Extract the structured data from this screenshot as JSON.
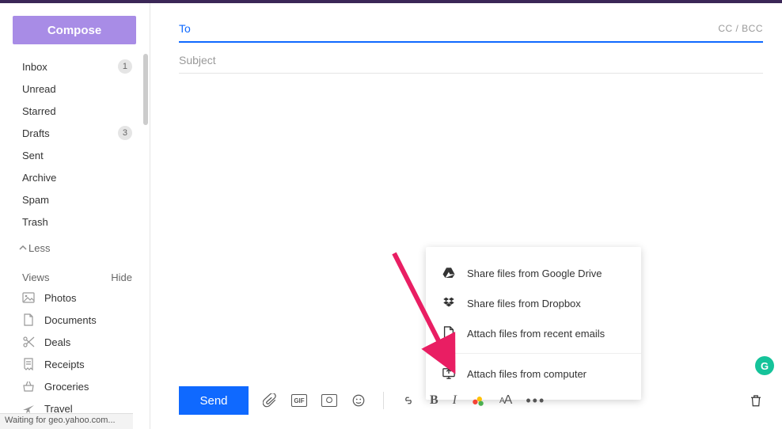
{
  "compose_label": "Compose",
  "folders": [
    {
      "label": "Inbox",
      "badge": "1"
    },
    {
      "label": "Unread",
      "badge": null
    },
    {
      "label": "Starred",
      "badge": null
    },
    {
      "label": "Drafts",
      "badge": "3"
    },
    {
      "label": "Sent",
      "badge": null
    },
    {
      "label": "Archive",
      "badge": null
    },
    {
      "label": "Spam",
      "badge": null
    },
    {
      "label": "Trash",
      "badge": null
    }
  ],
  "less_label": "Less",
  "views_header": "Views",
  "hide_label": "Hide",
  "views": [
    {
      "label": "Photos",
      "icon": "photos"
    },
    {
      "label": "Documents",
      "icon": "document"
    },
    {
      "label": "Deals",
      "icon": "scissors"
    },
    {
      "label": "Receipts",
      "icon": "receipt"
    },
    {
      "label": "Groceries",
      "icon": "basket"
    },
    {
      "label": "Travel",
      "icon": "plane"
    }
  ],
  "to_label": "To",
  "ccbcc_label": "CC / BCC",
  "subject_placeholder": "Subject",
  "send_label": "Send",
  "attach_menu": [
    {
      "label": "Share files from Google Drive",
      "icon": "gdrive"
    },
    {
      "label": "Share files from Dropbox",
      "icon": "dropbox"
    },
    {
      "label": "Attach files from recent emails",
      "icon": "file"
    },
    {
      "label": "Attach files from computer",
      "icon": "computer"
    }
  ],
  "statusbar_text": "Waiting for geo.yahoo.com...",
  "grammarly_letter": "G"
}
